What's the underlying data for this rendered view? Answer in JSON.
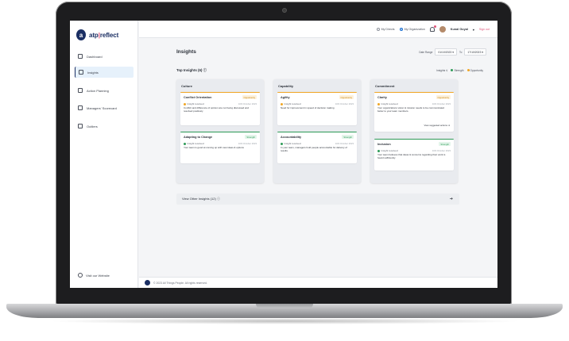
{
  "brand": {
    "mark": "a",
    "name_part1": "atp",
    "separator": "|",
    "name_part2": "reflect"
  },
  "sidebar": {
    "items": [
      {
        "label": "Dashboard",
        "active": false
      },
      {
        "label": "Insights",
        "active": true
      },
      {
        "label": "Action Planning",
        "active": false
      },
      {
        "label": "Managers' Scorecard",
        "active": false
      },
      {
        "label": "Outliers",
        "active": false
      }
    ],
    "visit_label": "Visit our Website"
  },
  "topbar": {
    "my_directs": "My Directs",
    "my_organization": "My Organization",
    "user_name": "Kunal Goyal",
    "sign_out": "Sign out"
  },
  "page": {
    "title": "Insights",
    "date_range_label": "Date Range",
    "date_from": "01/10/2023",
    "to_label": "To",
    "date_to": "17/10/2023",
    "top_insights_title": "Top Insights (6)",
    "legend_insights": "Insights",
    "legend_strength": "Strength",
    "legend_opportunity": "Opportunity"
  },
  "colors": {
    "strength": "#2e9b58",
    "opportunity": "#f0a524",
    "brand": "#1b2f63",
    "accent": "#e0557a"
  },
  "columns": [
    {
      "title": "Culture",
      "cards": [
        {
          "title": "Conflict Orientation",
          "tag": "Opportunity",
          "type": "opp",
          "meta": "Insight received",
          "date": "10th October 2023",
          "desc": "Conflict and difference of opinion are not being discussed and resolved positively",
          "action": ""
        },
        {
          "title": "Adapting to Change",
          "tag": "Strength",
          "type": "str",
          "meta": "Insight received",
          "date": "10th October 2023",
          "desc": "Your team is good at coming up with new ideas & options",
          "action": ""
        }
      ]
    },
    {
      "title": "Capability",
      "cards": [
        {
          "title": "Agility",
          "tag": "Opportunity",
          "type": "opp",
          "meta": "Insight received",
          "date": "10th October 2023",
          "desc": "Need for improvement in speed of decision making",
          "action": ""
        },
        {
          "title": "Accountability",
          "tag": "Strength",
          "type": "str",
          "meta": "Insight received",
          "date": "10th October 2023",
          "desc": "In your team, managers hold people accountable for delivery of results.",
          "action": ""
        }
      ]
    },
    {
      "title": "Commitment",
      "cards": [
        {
          "title": "Clarity",
          "tag": "Opportunity",
          "type": "opp",
          "meta": "Insight received",
          "date": "10th October 2023",
          "desc": "Your organizations vision & mission needs to be communicated better to your team members.",
          "action": "View suggested actions"
        },
        {
          "title": "Inclusion",
          "tag": "Strength",
          "type": "str",
          "meta": "Insight received",
          "date": "10th October 2023",
          "desc": "Your team believes that ideas & concerns regarding their work is heard sufficiently",
          "action": ""
        }
      ]
    }
  ],
  "other_insights": "View Other Insights (12)",
  "footer": "© 2023 All Things People. All rights reserved."
}
